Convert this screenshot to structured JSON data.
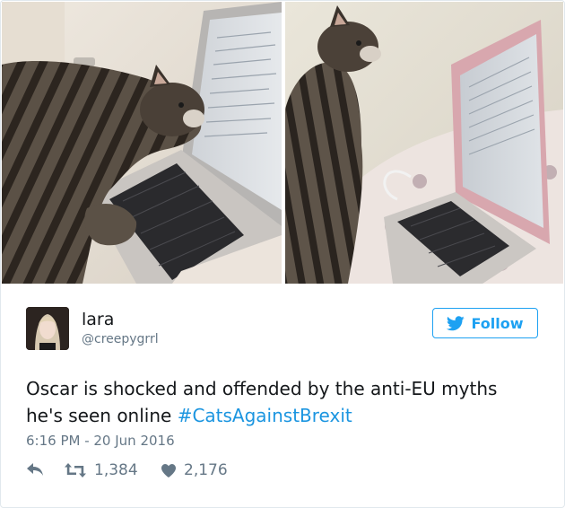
{
  "tweet": {
    "author": {
      "name": "lara",
      "handle": "@creepygrrl"
    },
    "follow_label": "Follow",
    "text_line1": "Oscar is shocked and offended by the anti-EU myths",
    "text_line2_plain": "he's seen online ",
    "hashtag": "#CatsAgainstBrexit",
    "timestamp": "6:16 PM - 20 Jun 2016",
    "retweets": "1,384",
    "likes": "2,176"
  },
  "icons": {
    "reply": "reply-icon",
    "retweet": "retweet-icon",
    "like": "heart-icon",
    "follow": "twitter-bird-icon"
  },
  "colors": {
    "accent": "#1da1f2",
    "hashtag": "#1b95e0",
    "secondary_text": "#657786",
    "primary_text": "#14171a"
  }
}
